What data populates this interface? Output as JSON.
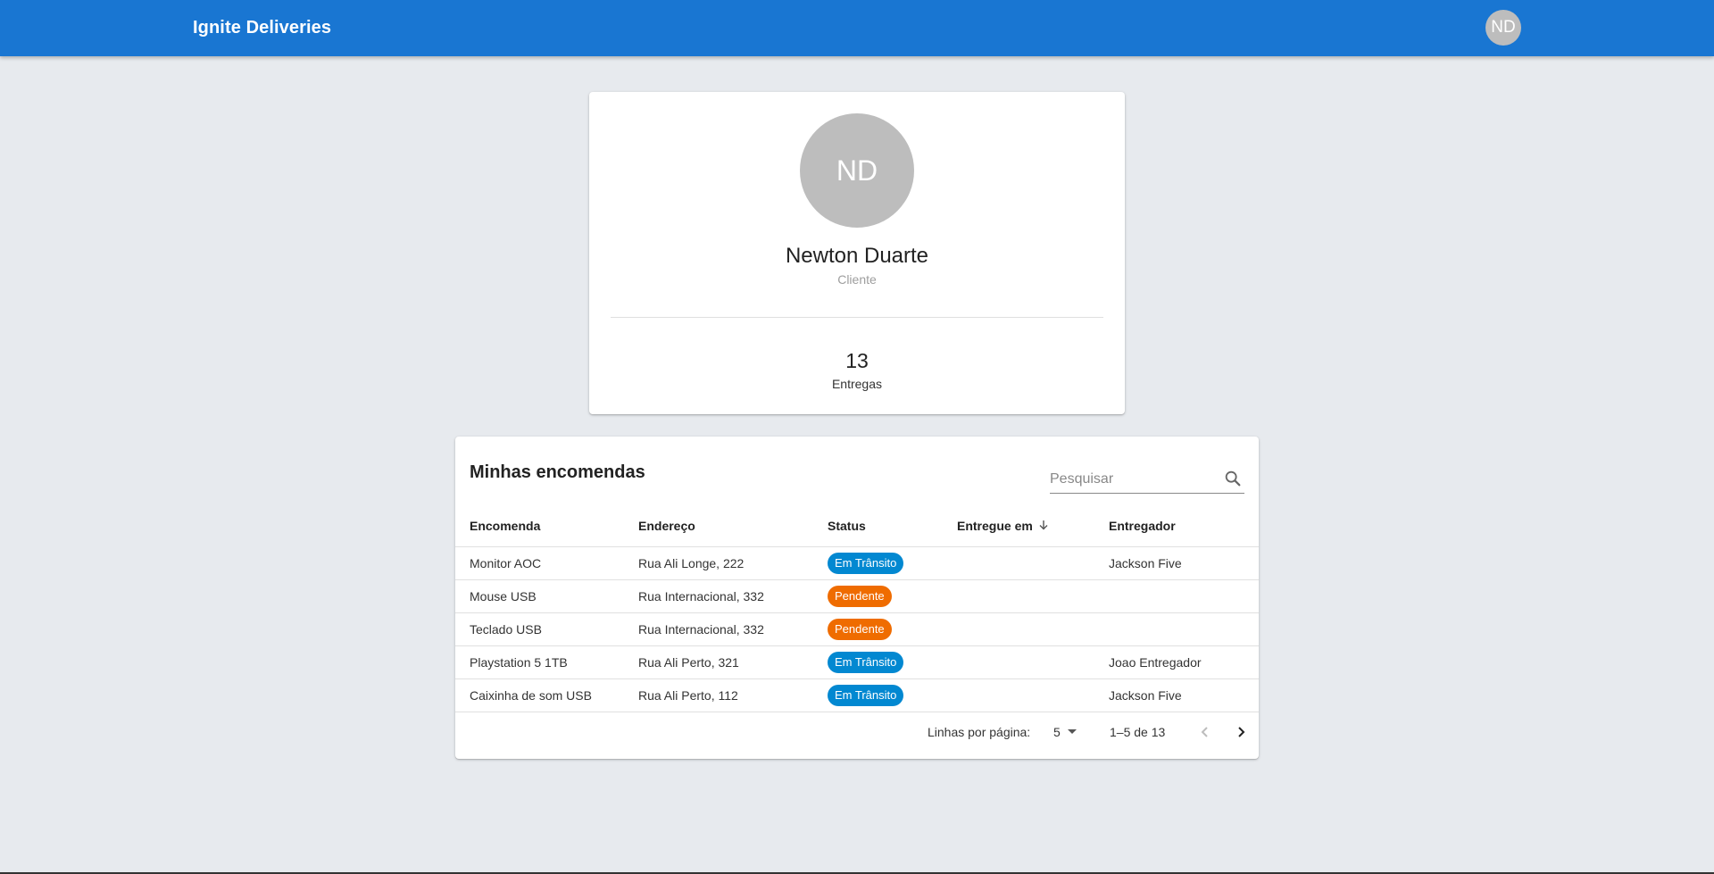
{
  "header": {
    "brand": "Ignite Deliveries",
    "avatar_initials": "ND"
  },
  "profile": {
    "initials": "ND",
    "name": "Newton Duarte",
    "role": "Cliente",
    "stat_value": "13",
    "stat_label": "Entregas"
  },
  "orders": {
    "title": "Minhas encomendas",
    "search_placeholder": "Pesquisar",
    "search_value": "",
    "columns": [
      "Encomenda",
      "Endereço",
      "Status",
      "Entregue em",
      "Entregador"
    ],
    "sort_icon": "arrow-down-icon",
    "rows": [
      {
        "item": "Monitor AOC",
        "address": "Rua Ali Longe, 222",
        "status": "Em Trânsito",
        "status_color": "#0288d1",
        "delivered": "",
        "courier": "Jackson Five"
      },
      {
        "item": "Mouse USB",
        "address": "Rua Internacional, 332",
        "status": "Pendente",
        "status_color": "#ef6c00",
        "delivered": "",
        "courier": ""
      },
      {
        "item": "Teclado USB",
        "address": "Rua Internacional, 332",
        "status": "Pendente",
        "status_color": "#ef6c00",
        "delivered": "",
        "courier": ""
      },
      {
        "item": "Playstation 5 1TB",
        "address": "Rua Ali Perto, 321",
        "status": "Em Trânsito",
        "status_color": "#0288d1",
        "delivered": "",
        "courier": "Joao Entregador"
      },
      {
        "item": "Caixinha de som USB",
        "address": "Rua Ali Perto, 112",
        "status": "Em Trânsito",
        "status_color": "#0288d1",
        "delivered": "",
        "courier": "Jackson Five"
      }
    ],
    "pagination": {
      "rows_per_page_label": "Linhas por página:",
      "rows_per_page": "5",
      "range": "1–5 de 13"
    }
  },
  "colors": {
    "appbar": "#1976d2",
    "background": "#e7eaee",
    "in_transit": "#0288d1",
    "pending": "#ef6c00"
  }
}
